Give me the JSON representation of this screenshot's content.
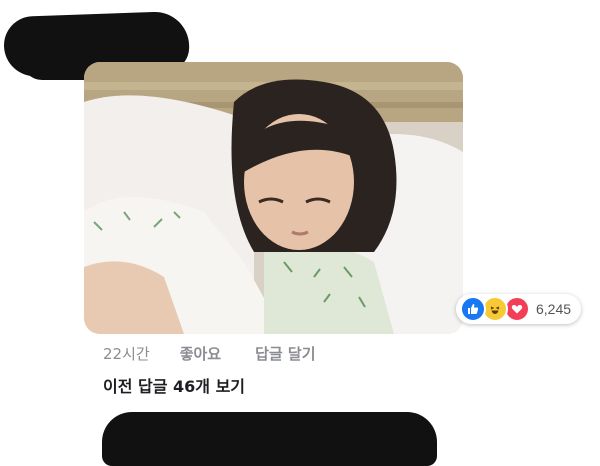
{
  "comment": {
    "time": "22시간",
    "like_label": "좋아요",
    "reply_label": "답글 달기"
  },
  "reactions": {
    "icons": [
      "like-icon",
      "haha-icon",
      "love-icon"
    ],
    "count": "6,245",
    "colors": {
      "like": "#1877f2",
      "haha": "#f7c934",
      "love": "#f33e58"
    }
  },
  "replies": {
    "view_previous_label": "이전 답글 46개 보기"
  }
}
